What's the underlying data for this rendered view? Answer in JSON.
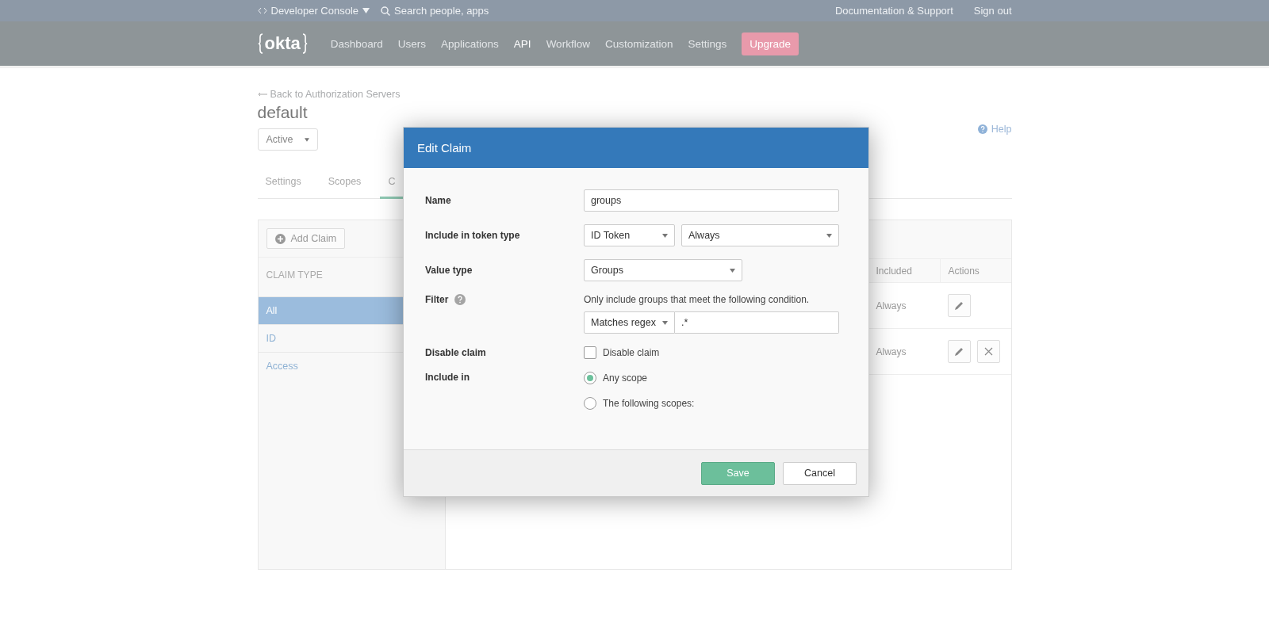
{
  "top_bar": {
    "console_label": "Developer Console",
    "search_placeholder": "Search people, apps",
    "links": [
      "Documentation & Support",
      "Sign out"
    ]
  },
  "nav": {
    "logo": "okta",
    "items": [
      {
        "label": "Dashboard",
        "selected": false
      },
      {
        "label": "Users",
        "selected": false
      },
      {
        "label": "Applications",
        "selected": false
      },
      {
        "label": "API",
        "selected": true
      },
      {
        "label": "Workflow",
        "selected": false
      },
      {
        "label": "Customization",
        "selected": false
      },
      {
        "label": "Settings",
        "selected": false
      }
    ],
    "upgrade": "Upgrade"
  },
  "page": {
    "back_link": "Back to Authorization Servers",
    "title": "default",
    "status_select": "Active",
    "help": "Help",
    "tabs": [
      {
        "label": "Settings",
        "selected": false
      },
      {
        "label": "Scopes",
        "selected": false
      },
      {
        "label": "C",
        "selected": true
      }
    ],
    "add_claim": "Add Claim",
    "claim_type_header": "CLAIM TYPE",
    "claim_types": [
      {
        "label": "All",
        "selected": true
      },
      {
        "label": "ID",
        "selected": false
      },
      {
        "label": "Access",
        "selected": false
      }
    ],
    "table": {
      "columns": [
        "Included",
        "Actions"
      ],
      "rows": [
        {
          "included": "Always",
          "deletable": false
        },
        {
          "included": "Always",
          "deletable": true
        }
      ]
    }
  },
  "dialog": {
    "title": "Edit Claim",
    "name_label": "Name",
    "name_value": "groups",
    "token_label": "Include in token type",
    "token_type": "ID Token",
    "token_when": "Always",
    "value_type_label": "Value type",
    "value_type": "Groups",
    "filter_label": "Filter",
    "filter_hint": "Only include groups that meet the following condition.",
    "filter_operator": "Matches regex",
    "filter_value": ".*",
    "disable_label": "Disable claim",
    "disable_checkbox": {
      "label": "Disable claim",
      "checked": false
    },
    "include_label": "Include in",
    "include_options": [
      {
        "label": "Any scope",
        "selected": true
      },
      {
        "label": "The following scopes:",
        "selected": false
      }
    ],
    "buttons": {
      "save": "Save",
      "cancel": "Cancel"
    }
  }
}
